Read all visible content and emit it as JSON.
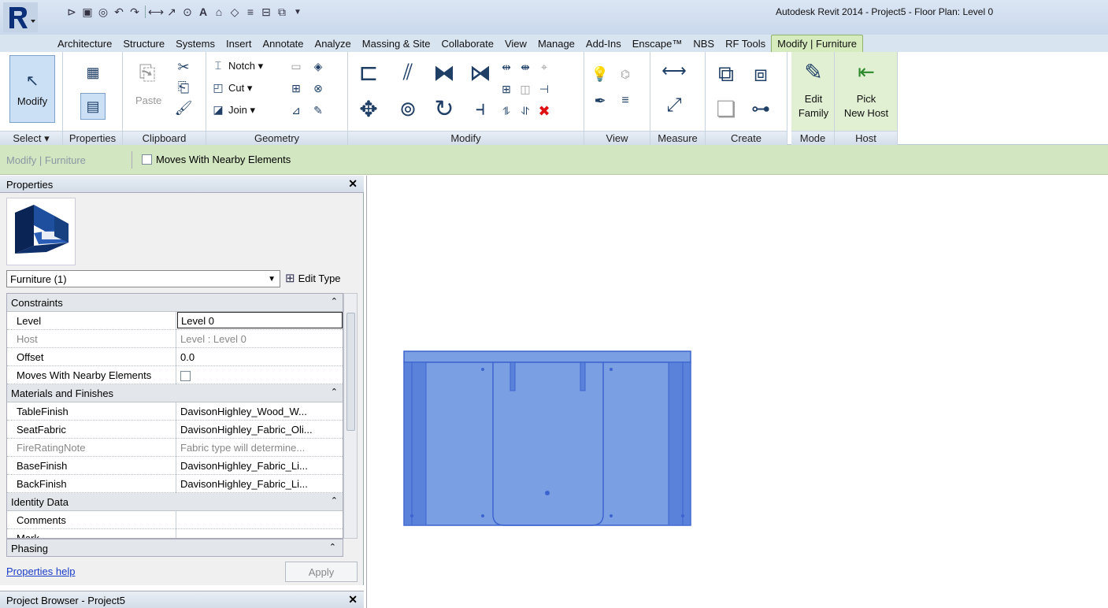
{
  "window": {
    "title": "Autodesk Revit 2014 -    Project5 - Floor Plan: Level 0"
  },
  "tabs": [
    "Architecture",
    "Structure",
    "Systems",
    "Insert",
    "Annotate",
    "Analyze",
    "Massing & Site",
    "Collaborate",
    "View",
    "Manage",
    "Add-Ins",
    "Enscape™",
    "NBS",
    "RF Tools",
    "Modify | Furniture"
  ],
  "active_tab": "Modify | Furniture",
  "ribbon": {
    "select": {
      "modify": "Modify",
      "label": "Select"
    },
    "properties": {
      "label": "Properties"
    },
    "clipboard": {
      "paste": "Paste",
      "label": "Clipboard"
    },
    "geometry": {
      "notch": "Notch",
      "cut": "Cut",
      "join": "Join",
      "label": "Geometry"
    },
    "modify": {
      "label": "Modify"
    },
    "view": {
      "label": "View"
    },
    "measure": {
      "label": "Measure"
    },
    "create": {
      "label": "Create"
    },
    "mode": {
      "edit_family_1": "Edit",
      "edit_family_2": "Family",
      "label": "Mode"
    },
    "host": {
      "pick_1": "Pick",
      "pick_2": "New Host",
      "label": "Host"
    }
  },
  "options_bar": {
    "context": "Modify | Furniture",
    "moves_with_nearby": "Moves With Nearby Elements"
  },
  "properties": {
    "title": "Properties",
    "type_selector": "Furniture (1)",
    "edit_type": "Edit Type",
    "groups": {
      "constraints": "Constraints",
      "materials": "Materials and Finishes",
      "identity": "Identity Data",
      "phasing": "Phasing"
    },
    "rows": {
      "level": {
        "key": "Level",
        "value": "Level 0"
      },
      "host": {
        "key": "Host",
        "value": "Level : Level 0"
      },
      "offset": {
        "key": "Offset",
        "value": "0.0"
      },
      "moves": {
        "key": "Moves With Nearby Elements",
        "value": false
      },
      "table_finish": {
        "key": "TableFinish",
        "value": "DavisonHighley_Wood_W..."
      },
      "seat_fabric": {
        "key": "SeatFabric",
        "value": "DavisonHighley_Fabric_Oli..."
      },
      "fire_rating": {
        "key": "FireRatingNote",
        "value": "Fabric type will determine..."
      },
      "base_finish": {
        "key": "BaseFinish",
        "value": "DavisonHighley_Fabric_Li..."
      },
      "back_finish": {
        "key": "BackFinish",
        "value": "DavisonHighley_Fabric_Li..."
      },
      "comments": {
        "key": "Comments",
        "value": ""
      },
      "mark": {
        "key": "Mark",
        "value": ""
      }
    },
    "help_link": "Properties help",
    "apply": "Apply"
  },
  "project_browser": {
    "title": "Project Browser - Project5"
  },
  "colors": {
    "selection_blue": "#7b9fe3",
    "selection_edge": "#3c64cf",
    "ribbon_context": "#d6ecbf"
  }
}
